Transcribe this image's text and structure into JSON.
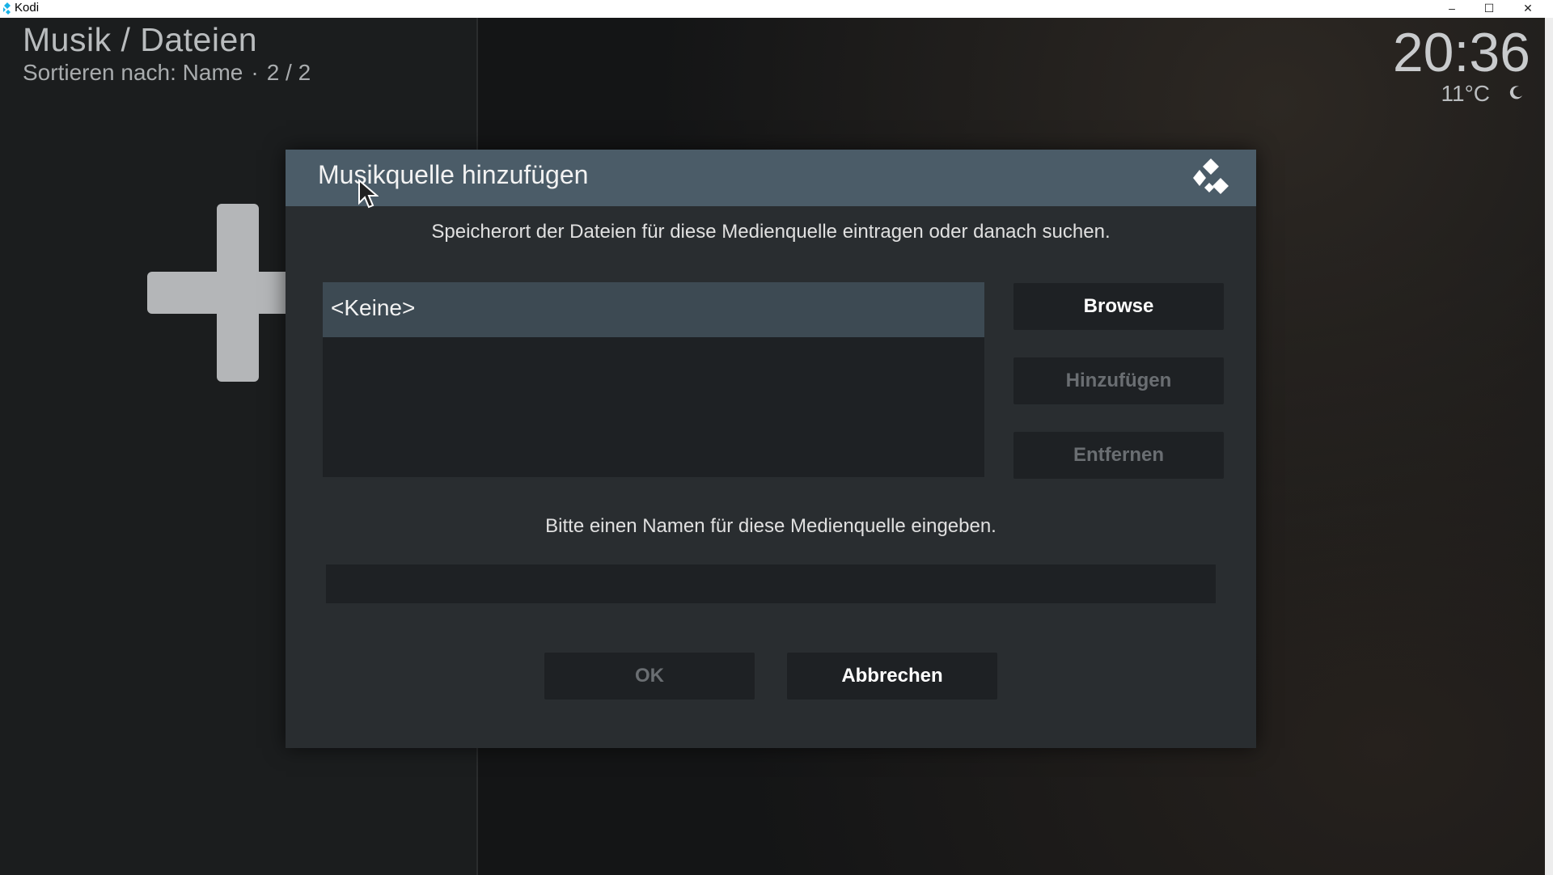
{
  "window": {
    "app_title": "Kodi",
    "app_icon": "kodi-icon",
    "minimize_glyph": "–",
    "maximize_glyph": "☐",
    "close_glyph": "✕"
  },
  "header": {
    "title": "Musik / Dateien",
    "sort_label": "Sortieren nach: Name",
    "separator": "·",
    "page_indicator": "2 / 2"
  },
  "status": {
    "time": "20:36",
    "temperature": "11°C",
    "weather_icon": "moon-icon"
  },
  "background": {
    "icon": "plus-icon"
  },
  "dialog": {
    "title": "Musikquelle hinzufügen",
    "logo_icon": "kodi-logo-icon",
    "path_prompt": "Speicherort der Dateien für diese Medienquelle eintragen oder danach suchen.",
    "path_items": [
      "<Keine>"
    ],
    "buttons": {
      "browse": "Browse",
      "add": "Hinzufügen",
      "remove": "Entfernen",
      "ok": "OK",
      "cancel": "Abbrechen"
    },
    "name_prompt": "Bitte einen Namen für diese Medienquelle eingeben.",
    "name_value": ""
  },
  "colors": {
    "dialog_header": "#4b5c68",
    "dialog_body": "#292d30",
    "selected_item": "#3d4a53",
    "button_bg": "#1e2124",
    "disabled_text": "#6a6e72"
  }
}
